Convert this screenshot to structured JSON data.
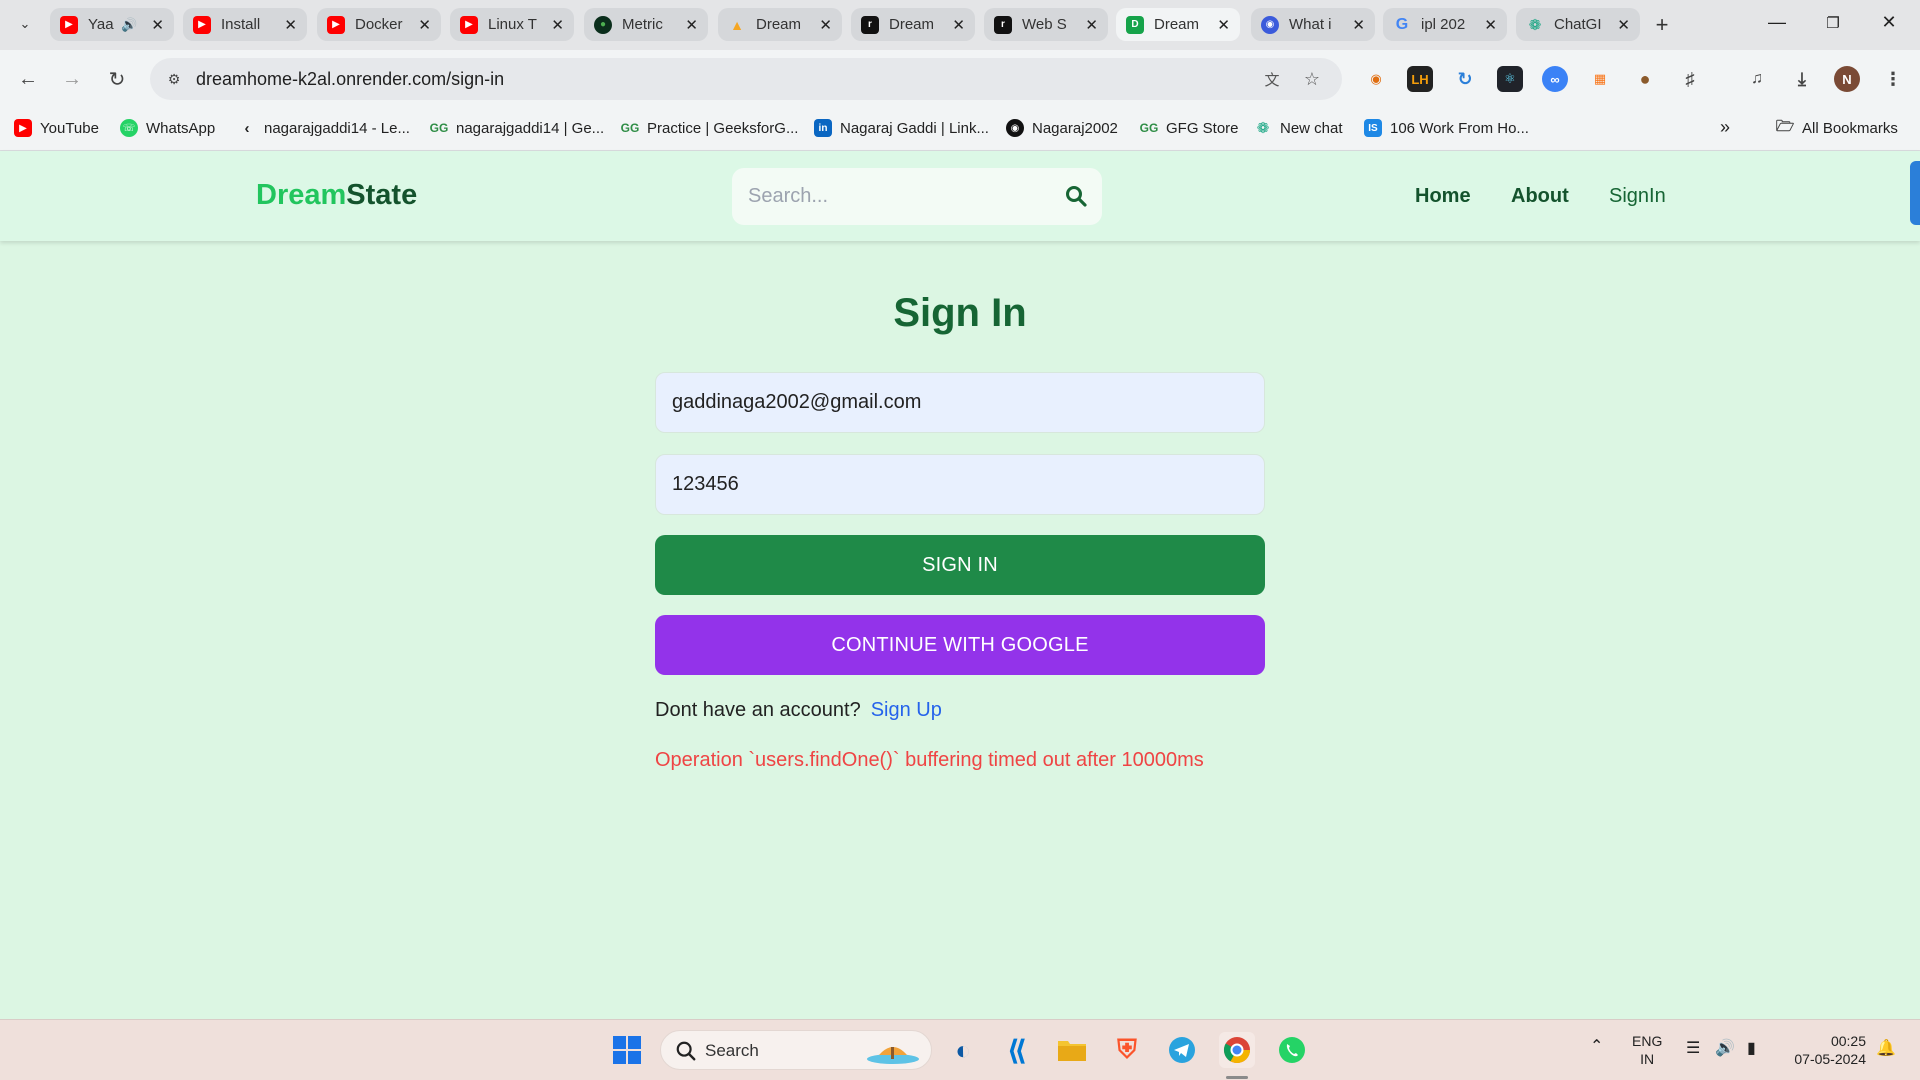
{
  "browser": {
    "tabs": [
      {
        "title": "Yaa",
        "icon": "youtube-icon",
        "audio": true
      },
      {
        "title": "Install",
        "icon": "youtube-icon"
      },
      {
        "title": "Docker",
        "icon": "youtube-icon"
      },
      {
        "title": "Linux T",
        "icon": "youtube-icon"
      },
      {
        "title": "Metric",
        "icon": "mongodb-icon"
      },
      {
        "title": "Dream",
        "icon": "firebase-icon"
      },
      {
        "title": "Dream",
        "icon": "render-icon"
      },
      {
        "title": "Web S",
        "icon": "render-icon"
      },
      {
        "title": "Dream",
        "icon": "dreamstate-icon",
        "active": true
      },
      {
        "title": "What i",
        "icon": "globe-icon"
      },
      {
        "title": "ipl 202",
        "icon": "google-icon"
      },
      {
        "title": "ChatGI",
        "icon": "chatgpt-icon"
      }
    ],
    "url": "dreamhome-k2al.onrender.com/sign-in",
    "bookmarks": [
      {
        "label": "YouTube",
        "icon": "youtube-icon"
      },
      {
        "label": "WhatsApp",
        "icon": "whatsapp-icon"
      },
      {
        "label": "nagarajgaddi14 - Le...",
        "icon": "leetcode-icon"
      },
      {
        "label": "nagarajgaddi14 | Ge...",
        "icon": "gfg-icon"
      },
      {
        "label": "Practice | GeeksforG...",
        "icon": "gfg-icon"
      },
      {
        "label": "Nagaraj Gaddi | Link...",
        "icon": "linkedin-icon"
      },
      {
        "label": "Nagaraj2002",
        "icon": "github-icon"
      },
      {
        "label": "GFG Store",
        "icon": "gfg-icon"
      },
      {
        "label": "New chat",
        "icon": "chatgpt-icon"
      },
      {
        "label": "106 Work From Ho...",
        "icon": "is-icon"
      }
    ],
    "all_bookmarks": "All Bookmarks"
  },
  "site": {
    "logo_part1": "Dream",
    "logo_part2": "State",
    "search_placeholder": "Search...",
    "nav": {
      "home": "Home",
      "about": "About",
      "signin": "SignIn"
    }
  },
  "signin": {
    "title": "Sign In",
    "email_value": "gaddinaga2002@gmail.com",
    "password_value": "123456",
    "signin_button": "SIGN IN",
    "google_button": "CONTINUE WITH GOOGLE",
    "no_account_text": "Dont have an account?",
    "signup_link": "Sign Up",
    "error_message": "Operation `users.findOne()` buffering timed out after 10000ms"
  },
  "taskbar": {
    "search_label": "Search",
    "lang_line1": "ENG",
    "lang_line2": "IN",
    "time": "00:25",
    "date": "07-05-2024"
  },
  "colors": {
    "page_bg": "#dcf6e3",
    "title_green": "#166534",
    "signin_green": "#1f8a48",
    "google_purple": "#9333ea",
    "link_blue": "#2563eb",
    "error_red": "#ef4444"
  }
}
